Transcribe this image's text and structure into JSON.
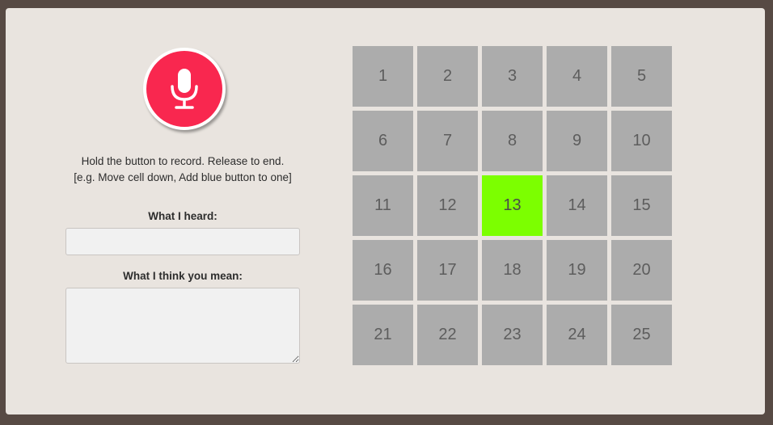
{
  "recorder": {
    "mic_icon": "microphone-icon",
    "instruction_line1": "Hold the button to record. Release to end.",
    "instruction_line2": "[e.g. Move cell down, Add blue button to one]"
  },
  "heard": {
    "label": "What I heard:",
    "value": ""
  },
  "meaning": {
    "label": "What I think you mean:",
    "value": ""
  },
  "grid": {
    "active_cell": "13",
    "active_color": "#7cff00",
    "cell_color": "#acacac",
    "cells": [
      "1",
      "2",
      "3",
      "4",
      "5",
      "6",
      "7",
      "8",
      "9",
      "10",
      "11",
      "12",
      "13",
      "14",
      "15",
      "16",
      "17",
      "18",
      "19",
      "20",
      "21",
      "22",
      "23",
      "24",
      "25"
    ]
  },
  "colors": {
    "record_button": "#f9274f",
    "background": "#e9e4df"
  }
}
